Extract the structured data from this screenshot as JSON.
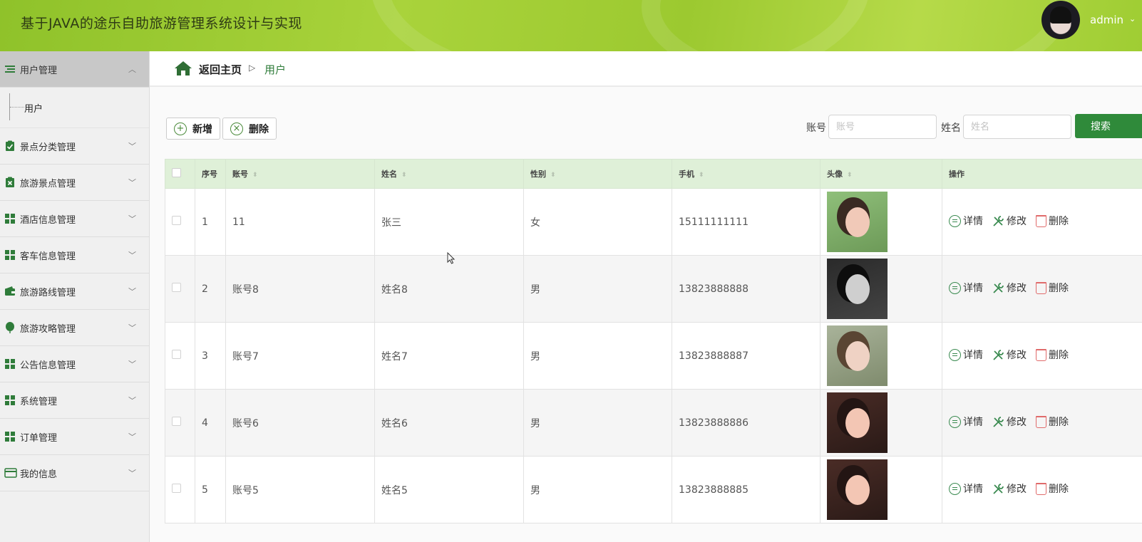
{
  "header": {
    "title": "基于JAVA的途乐自助旅游管理系统设计与实现",
    "username": "admin",
    "caret": "⌄"
  },
  "sidebar": {
    "items": [
      {
        "label": "用户管理",
        "icon": "list-icon",
        "expanded": true
      },
      {
        "label": "景点分类管理",
        "icon": "clipboard-check-icon"
      },
      {
        "label": "旅游景点管理",
        "icon": "clipboard-x-icon"
      },
      {
        "label": "酒店信息管理",
        "icon": "grid-icon"
      },
      {
        "label": "客车信息管理",
        "icon": "grid-icon"
      },
      {
        "label": "旅游路线管理",
        "icon": "wallet-icon"
      },
      {
        "label": "旅游攻略管理",
        "icon": "balloon-icon"
      },
      {
        "label": "公告信息管理",
        "icon": "grid-icon"
      },
      {
        "label": "系统管理",
        "icon": "grid-icon"
      },
      {
        "label": "订单管理",
        "icon": "grid-icon"
      },
      {
        "label": "我的信息",
        "icon": "card-icon"
      }
    ],
    "submenu": {
      "label": "用户"
    }
  },
  "breadcrumb": {
    "home": "返回主页",
    "separator": "▷",
    "current": "用户"
  },
  "toolbar": {
    "add_label": "新增",
    "delete_label": "删除"
  },
  "search": {
    "account_label": "账号",
    "account_placeholder": "账号",
    "name_label": "姓名",
    "name_placeholder": "姓名",
    "button": "搜索"
  },
  "table": {
    "columns": [
      "序号",
      "账号",
      "姓名",
      "性别",
      "手机",
      "头像",
      "操作"
    ],
    "rows": [
      {
        "index": "1",
        "account": "11",
        "name": "张三",
        "gender": "女",
        "phone": "15111111111"
      },
      {
        "index": "2",
        "account": "账号8",
        "name": "姓名8",
        "gender": "男",
        "phone": "13823888888"
      },
      {
        "index": "3",
        "account": "账号7",
        "name": "姓名7",
        "gender": "男",
        "phone": "13823888887"
      },
      {
        "index": "4",
        "account": "账号6",
        "name": "姓名6",
        "gender": "男",
        "phone": "13823888886"
      },
      {
        "index": "5",
        "account": "账号5",
        "name": "姓名5",
        "gender": "男",
        "phone": "13823888885"
      }
    ],
    "actions": {
      "detail": "详情",
      "edit": "修改",
      "delete": "删除"
    }
  },
  "colors": {
    "accent": "#2f8a3a",
    "header_bg": "#a3ce38",
    "table_header_bg": "#dff0d8",
    "delete_icon": "#e06b6b"
  }
}
